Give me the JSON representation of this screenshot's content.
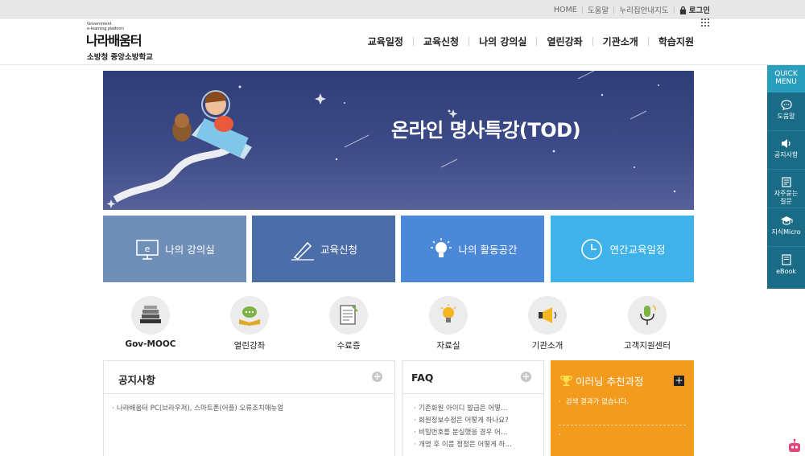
{
  "utility": {
    "home": "HOME",
    "help": "도움말",
    "sitemap": "누리집안내지도",
    "login": "로그인"
  },
  "logo": {
    "gov_line1": "Government",
    "gov_line2": "e-learning platform",
    "main": "나라배움터",
    "sub": "소방청 중앙소방학교"
  },
  "gnb": [
    "교육일정",
    "교육신청",
    "나의 강의실",
    "열린강좌",
    "기관소개",
    "학습지원"
  ],
  "banner": {
    "title": "온라인 명사특강(TOD)"
  },
  "tiles": [
    {
      "label": "나의 강의실",
      "icon": "monitor-icon"
    },
    {
      "label": "교육신청",
      "icon": "pen-icon"
    },
    {
      "label": "나의 활동공간",
      "icon": "lightbulb-icon"
    },
    {
      "label": "연간교육일정",
      "icon": "clock-icon"
    }
  ],
  "circles": [
    {
      "label": "Gov-MOOC",
      "icon": "books-icon"
    },
    {
      "label": "열린강좌",
      "icon": "book-chat-icon"
    },
    {
      "label": "수료증",
      "icon": "certificate-icon"
    },
    {
      "label": "자료실",
      "icon": "bulb-icon"
    },
    {
      "label": "기관소개",
      "icon": "megaphone-icon"
    },
    {
      "label": "고객지원센터",
      "icon": "microphone-icon"
    }
  ],
  "notice": {
    "title": "공지사항",
    "items": [
      "나라배움터 PC(브라우저), 스마트폰(어플) 오류조치매뉴얼"
    ]
  },
  "faq": {
    "title": "FAQ",
    "items": [
      "기존회원 아이디 발급은 어떻…",
      "회원정보수정은 어떻게 하나요?",
      "비밀번호를 분실했을 경우 어…",
      "개명 후 이름 정정은 어떻게 하…"
    ]
  },
  "recommend": {
    "title": "이러닝 추천과정",
    "empty": "검색 결과가 없습니다.",
    "plus": "+"
  },
  "quick": {
    "title_line1": "QUICK",
    "title_line2": "MENU",
    "items": [
      {
        "label": "도움말",
        "icon": "chat-icon"
      },
      {
        "label": "공지사항",
        "icon": "speaker-icon"
      },
      {
        "label": "자주묻는",
        "label2": "질문",
        "icon": "document-icon"
      },
      {
        "label": "지식Micro",
        "icon": "graduation-cap-icon"
      },
      {
        "label": "eBook",
        "icon": "ebook-icon"
      }
    ]
  },
  "colors": {
    "tile1": "#6f8fb8",
    "tile2": "#4b6ea8",
    "tile3": "#4c88d8",
    "tile4": "#3fb2ea",
    "recommend": "#f39b1c",
    "quick": "#1a6b86",
    "banner": "#35437f"
  }
}
